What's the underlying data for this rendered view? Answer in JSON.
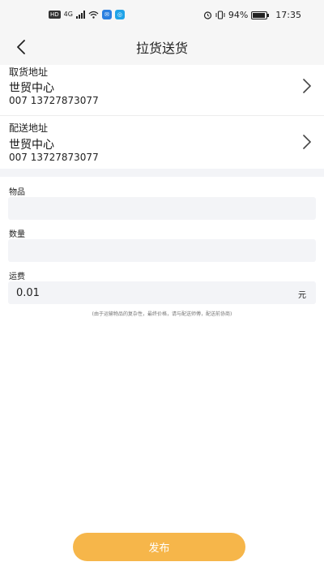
{
  "status_bar": {
    "hd": "HD",
    "network": "4G",
    "battery": "94%",
    "battery_level": 0.94,
    "time": "17:35",
    "icons": [
      "signal-icon",
      "wifi-icon",
      "app-badge-icon",
      "alarm-icon",
      "vibrate-icon",
      "battery-icon"
    ]
  },
  "header": {
    "title": "拉货送货",
    "back_icon": "back-arrow-icon"
  },
  "pickup": {
    "label": "取货地址",
    "name": "世贸中心",
    "phone": "007 13727873077"
  },
  "delivery": {
    "label": "配送地址",
    "name": "世贸中心",
    "phone": "007 13727873077"
  },
  "form": {
    "item_label": "物品",
    "item_value": "",
    "quantity_label": "数量",
    "quantity_value": "",
    "fee_label": "运费",
    "fee_value": "0.01",
    "fee_unit": "元",
    "note": "(由于运输物品的复杂性，最终价格，请与配送师傅，配送前协商)"
  },
  "actions": {
    "publish_label": "发布"
  },
  "colors": {
    "accent": "#f6b64a",
    "field_bg": "#f3f4f7"
  }
}
